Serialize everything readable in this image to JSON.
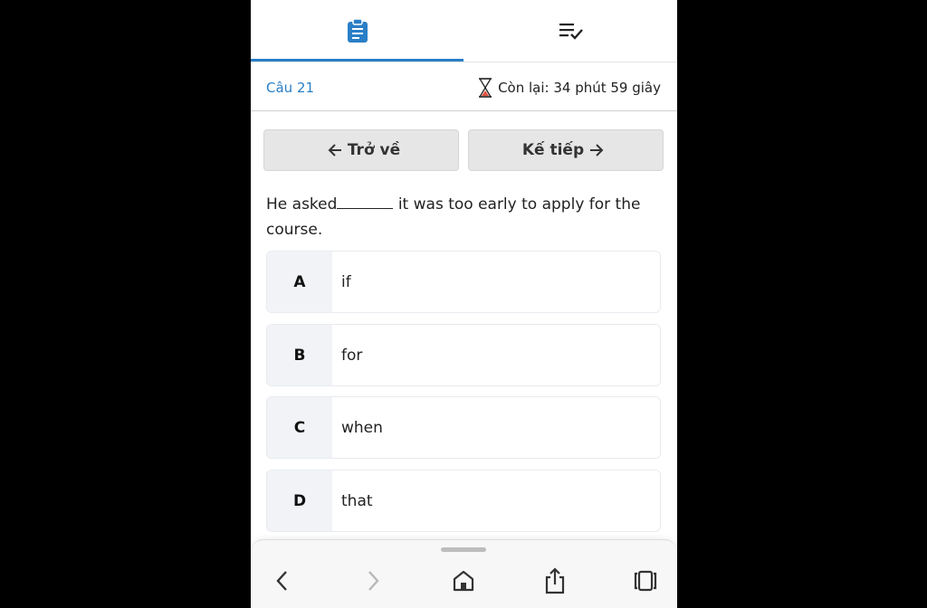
{
  "tabs": [
    {
      "icon": "clipboard-icon",
      "active": true
    },
    {
      "icon": "checklist-icon",
      "active": false
    }
  ],
  "question_header": {
    "number": "Câu 21",
    "timer_label": "Còn lại: 34 phút 59 giây"
  },
  "navigation": {
    "back_label": "Trở về",
    "next_label": "Kế tiếp"
  },
  "question": {
    "text_before": "He asked",
    "text_after": " it was too early to apply for the course."
  },
  "options": [
    {
      "letter": "A",
      "text": "if"
    },
    {
      "letter": "B",
      "text": "for"
    },
    {
      "letter": "C",
      "text": "when"
    },
    {
      "letter": "D",
      "text": "that"
    }
  ],
  "browser_bar": {
    "buttons": [
      "back-icon",
      "forward-icon",
      "home-icon",
      "share-icon",
      "tabs-icon"
    ]
  },
  "colors": {
    "accent": "#2a7fc7",
    "timer_icon": "#e0533f"
  }
}
